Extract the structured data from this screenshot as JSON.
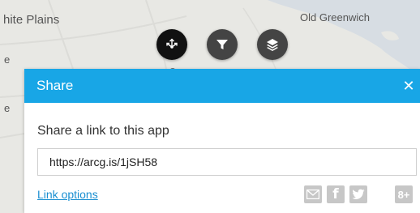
{
  "map": {
    "labels": {
      "white_plains": "hite Plains",
      "old_greenwich": "Old Greenwich",
      "edge_1": "e",
      "edge_2": "e"
    }
  },
  "toolbar": {
    "share_icon": "share-icon",
    "filter_icon": "filter-icon",
    "layers_icon": "layers-icon"
  },
  "panel": {
    "title": "Share",
    "heading": "Share a link to this app",
    "url": "https://arcg.is/1jSH58",
    "link_options_label": "Link options",
    "close_glyph": "✕",
    "social": {
      "email_icon": "email-icon",
      "facebook_label": "f",
      "twitter_icon": "twitter-icon",
      "googleplus_label": "8+"
    }
  },
  "colors": {
    "header": "#18a6e6",
    "link": "#1a8fd1",
    "tool_active": "#111111",
    "tool_inactive": "#444444"
  }
}
